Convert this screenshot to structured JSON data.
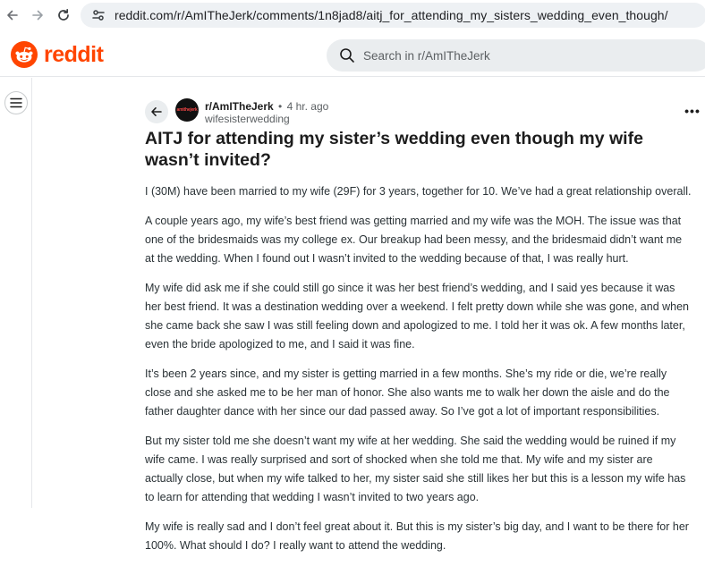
{
  "browser": {
    "url": "reddit.com/r/AmITheJerk/comments/1n8jad8/aitj_for_attending_my_sisters_wedding_even_though/"
  },
  "header": {
    "logo_text": "reddit",
    "search_placeholder": "Search in r/AmITheJerk",
    "brand_color": "#ff4500"
  },
  "post": {
    "subreddit": "r/AmITheJerk",
    "separator": "•",
    "time": "4 hr. ago",
    "author": "wifesisterwedding",
    "avatar_text": "amithejerk",
    "more_label": "•••",
    "title": "AITJ for attending my sister’s wedding even though my wife wasn’t invited?",
    "paragraphs": [
      "I (30M) have been married to my wife (29F) for 3 years, together for 10. We’ve had a great relationship overall.",
      "A couple years ago, my wife’s best friend was getting married and my wife was the MOH. The issue was that one of the bridesmaids was my college ex. Our breakup had been messy, and the bridesmaid didn’t want me at the wedding. When I found out I wasn’t invited to the wedding because of that, I was really hurt.",
      "My wife did ask me if she could still go since it was her best friend’s wedding, and I said yes because it was her best friend. It was a destination wedding over a weekend. I felt pretty down while she was gone, and when she came back she saw I was still feeling down and apologized to me. I told her it was ok. A few months later, even the bride apologized to me, and I said it was fine.",
      "It’s been 2 years since, and my sister is getting married in a few months. She’s my ride or die, we’re really close and she asked me to be her man of honor. She also wants me to walk her down the aisle and do the father daughter dance with her since our dad passed away. So I’ve got a lot of important responsibilities.",
      "But my sister told me she doesn’t want my wife at her wedding. She said the wedding would be ruined if my wife came. I was really surprised and sort of shocked when she told me that. My wife and my sister are actually close, but when my wife talked to her, my sister said she still likes her but this is a lesson my wife has to learn for attending that wedding I wasn’t invited to two years ago.",
      "My wife is really sad and I don’t feel great about it. But this is my sister’s big day, and I want to be there for her 100%. What should I do? I really want to attend the wedding."
    ]
  }
}
